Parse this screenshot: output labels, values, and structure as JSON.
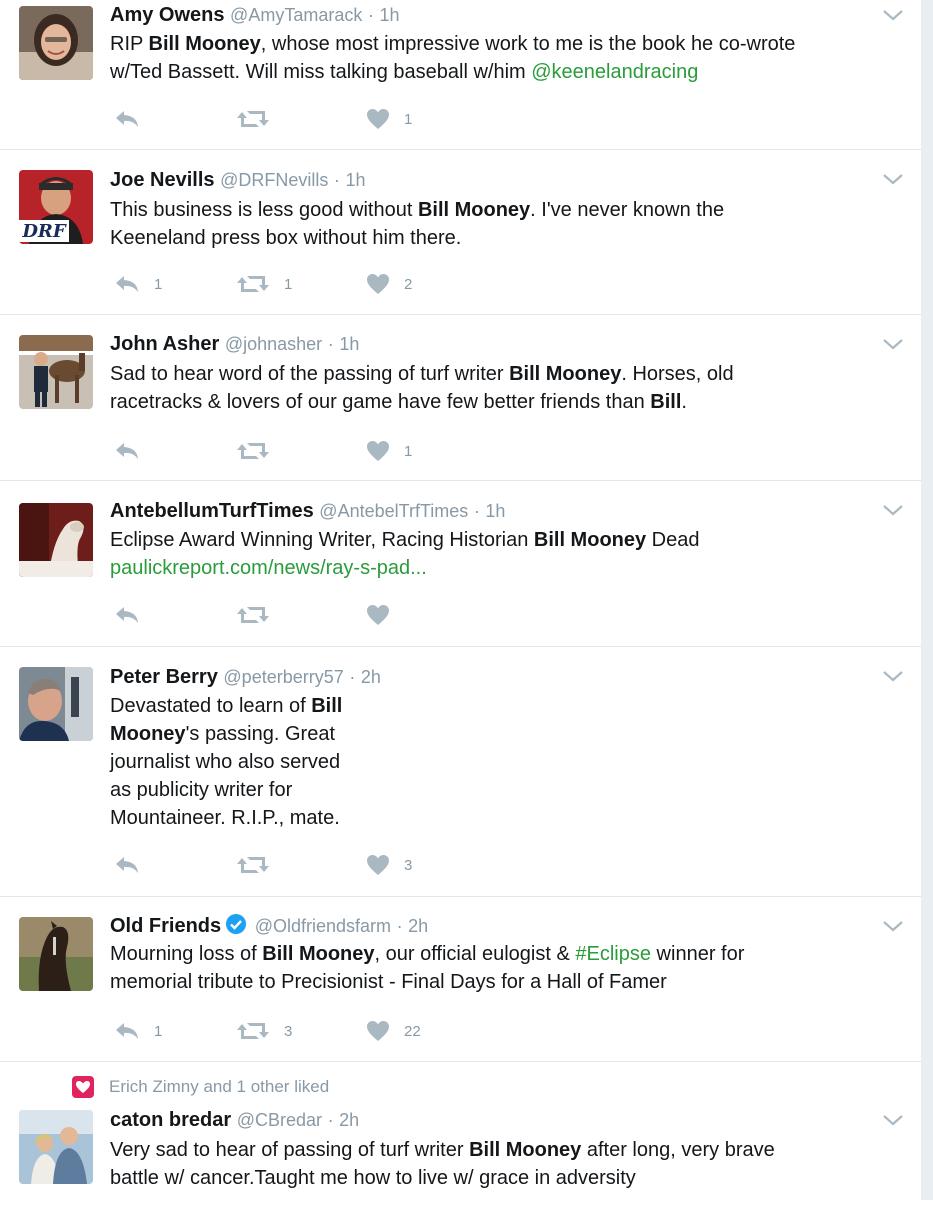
{
  "tweets": [
    {
      "name": "Amy Owens",
      "handle": "@AmyTamarack",
      "separator": "·",
      "time": "1h",
      "segments": [
        {
          "t": "RIP ",
          "s": "n"
        },
        {
          "t": "Bill Mooney",
          "s": "b"
        },
        {
          "t": ", whose most impressive work to me is the book he co-wrote",
          "s": "n"
        },
        {
          "t": "",
          "s": "br"
        },
        {
          "t": "w/Ted Bassett. Will miss talking baseball w/him ",
          "s": "n"
        },
        {
          "t": "@keenelandracing",
          "s": "l"
        }
      ],
      "reply_count": "",
      "retweet_count": "",
      "like_count": "1"
    },
    {
      "name": "Joe Nevills",
      "handle": "@DRFNevills",
      "separator": "·",
      "time": "1h",
      "avatar_text": "DRF",
      "segments": [
        {
          "t": "This business is less good without ",
          "s": "n"
        },
        {
          "t": "Bill Mooney",
          "s": "b"
        },
        {
          "t": ". I've never known the",
          "s": "n"
        },
        {
          "t": "",
          "s": "br"
        },
        {
          "t": "Keeneland press box without him there.",
          "s": "n"
        }
      ],
      "reply_count": "1",
      "retweet_count": "1",
      "like_count": "2"
    },
    {
      "name": "John Asher",
      "handle": "@johnasher",
      "separator": "·",
      "time": "1h",
      "segments": [
        {
          "t": "Sad to hear word of the passing of turf writer ",
          "s": "n"
        },
        {
          "t": "Bill Mooney",
          "s": "b"
        },
        {
          "t": ". Horses, old",
          "s": "n"
        },
        {
          "t": "",
          "s": "br"
        },
        {
          "t": "racetracks & lovers of our game have few better friends than ",
          "s": "n"
        },
        {
          "t": "Bill",
          "s": "b"
        },
        {
          "t": ".",
          "s": "n"
        }
      ],
      "reply_count": "",
      "retweet_count": "",
      "like_count": "1"
    },
    {
      "name": "AntebellumTurfTimes",
      "handle": "@AntebelTrfTimes",
      "separator": "·",
      "time": "1h",
      "segments": [
        {
          "t": "Eclipse Award Winning Writer, Racing Historian ",
          "s": "n"
        },
        {
          "t": "Bill Mooney",
          "s": "b"
        },
        {
          "t": " Dead",
          "s": "n"
        },
        {
          "t": "",
          "s": "br"
        },
        {
          "t": "paulickreport.com/news/ray-s-pad...",
          "s": "l"
        }
      ],
      "reply_count": "",
      "retweet_count": "",
      "like_count": ""
    },
    {
      "name": "Peter Berry",
      "handle": "@peterberry57",
      "separator": "·",
      "time": "2h",
      "segments": [
        {
          "t": "Devastated to learn of ",
          "s": "n"
        },
        {
          "t": "Bill",
          "s": "b"
        },
        {
          "t": "",
          "s": "br"
        },
        {
          "t": "Mooney",
          "s": "b"
        },
        {
          "t": "'s passing. Great",
          "s": "n"
        },
        {
          "t": "",
          "s": "br"
        },
        {
          "t": "journalist who also served",
          "s": "n"
        },
        {
          "t": "",
          "s": "br"
        },
        {
          "t": "as publicity writer for",
          "s": "n"
        },
        {
          "t": "",
          "s": "br"
        },
        {
          "t": "Mountaineer. R.I.P., mate.",
          "s": "n"
        }
      ],
      "reply_count": "",
      "retweet_count": "",
      "like_count": "3"
    },
    {
      "name": "Old Friends",
      "handle": "@Oldfriendsfarm",
      "separator": "·",
      "time": "2h",
      "verified": true,
      "segments": [
        {
          "t": "Mourning loss of ",
          "s": "n"
        },
        {
          "t": "Bill Mooney",
          "s": "b"
        },
        {
          "t": ", our official eulogist & ",
          "s": "n"
        },
        {
          "t": "#Eclipse",
          "s": "l"
        },
        {
          "t": " winner for",
          "s": "n"
        },
        {
          "t": "",
          "s": "br"
        },
        {
          "t": "memorial tribute to Precisionist - Final Days for a Hall of Famer",
          "s": "n"
        }
      ],
      "reply_count": "1",
      "retweet_count": "3",
      "like_count": "22"
    },
    {
      "name": "caton bredar",
      "handle": "@CBredar",
      "separator": "·",
      "time": "2h",
      "liked_by": "Erich Zimny and 1 other liked",
      "segments": [
        {
          "t": "Very sad to hear of passing of turf writer ",
          "s": "n"
        },
        {
          "t": "Bill Mooney",
          "s": "b"
        },
        {
          "t": " after long, very  brave",
          "s": "n"
        },
        {
          "t": "",
          "s": "br"
        },
        {
          "t": "battle w/ cancer.Taught me how to live w/ grace in adversity",
          "s": "n"
        }
      ],
      "reply_count": "",
      "retweet_count": "",
      "like_count": ""
    }
  ],
  "colors": {
    "icon": "#aab8c2",
    "link": "#2a9c3b",
    "muted": "#8899a6",
    "verified": "#1da1f2",
    "liked_heart": "#e0245e"
  },
  "icons": {
    "reply": "reply-icon",
    "retweet": "retweet-icon",
    "like": "heart-icon",
    "more": "chevron-down-icon",
    "verified": "verified-badge-icon"
  }
}
